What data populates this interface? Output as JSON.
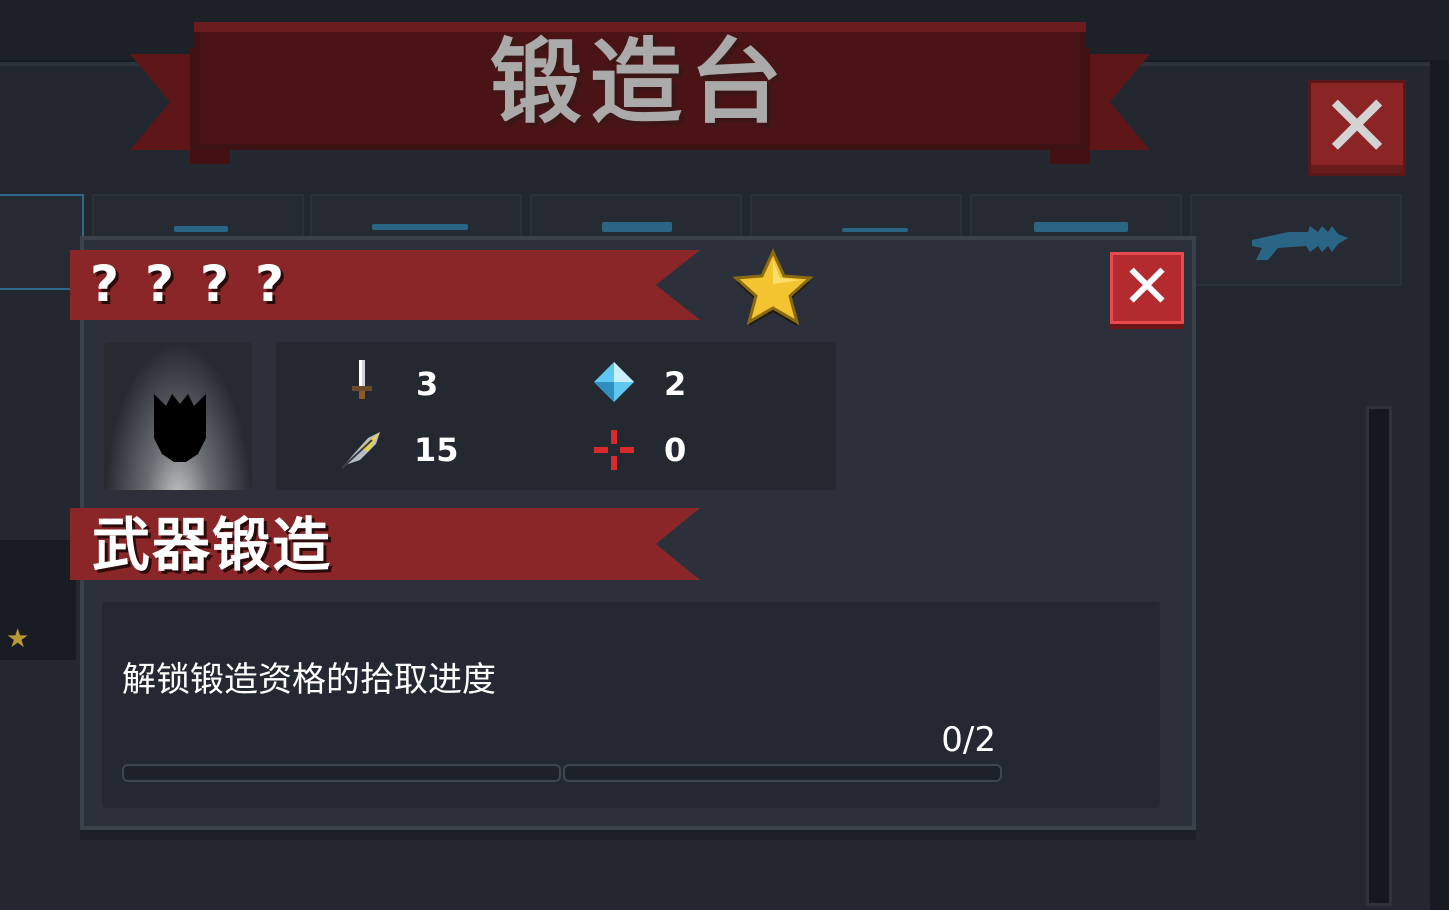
{
  "header": {
    "title": "锻造台"
  },
  "popup": {
    "weapon_name": "????",
    "rarity_icon": "star-icon",
    "stats": [
      {
        "icon": "sword-icon",
        "value": "3"
      },
      {
        "icon": "energy-crystal-icon",
        "value": "2"
      },
      {
        "icon": "feather-icon",
        "value": "15"
      },
      {
        "icon": "crosshair-icon",
        "value": "0"
      }
    ],
    "section_title": "武器锻造",
    "description": "解锁锻造资格的拾取进度",
    "progress": {
      "current": 0,
      "total": 2,
      "text": "0/2"
    }
  },
  "colors": {
    "banner_red": "#8a2628",
    "close_red": "#b32a2f",
    "panel": "#2b303a",
    "star_gold": "#f4c430"
  }
}
